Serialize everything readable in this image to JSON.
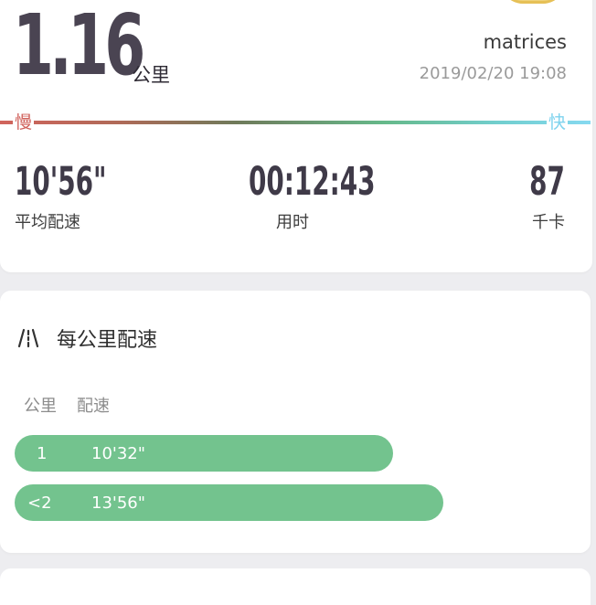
{
  "summary": {
    "distance_value": "1.16",
    "distance_unit": "公里",
    "username": "matrices",
    "datetime": "2019/02/20 19:08",
    "pace_scale": {
      "slow_label": "慢",
      "fast_label": "快",
      "gradient_colors": [
        "#d1645c",
        "#6f7a5a",
        "#66b98a",
        "#86d9f0"
      ]
    },
    "stats": {
      "avg_pace": {
        "value": "10'56\"",
        "label": "平均配速"
      },
      "duration": {
        "value": "00:12:43",
        "label": "用时"
      },
      "calories": {
        "value": "87",
        "label": "千卡"
      }
    }
  },
  "pace_card": {
    "icon": "road-icon",
    "title": "每公里配速",
    "columns": [
      "公里",
      "配速"
    ],
    "rows": [
      {
        "km": "1",
        "pace": "10'32\""
      },
      {
        "km": "<2",
        "pace": "13'56\""
      }
    ],
    "bar_color": "#73c38e"
  }
}
